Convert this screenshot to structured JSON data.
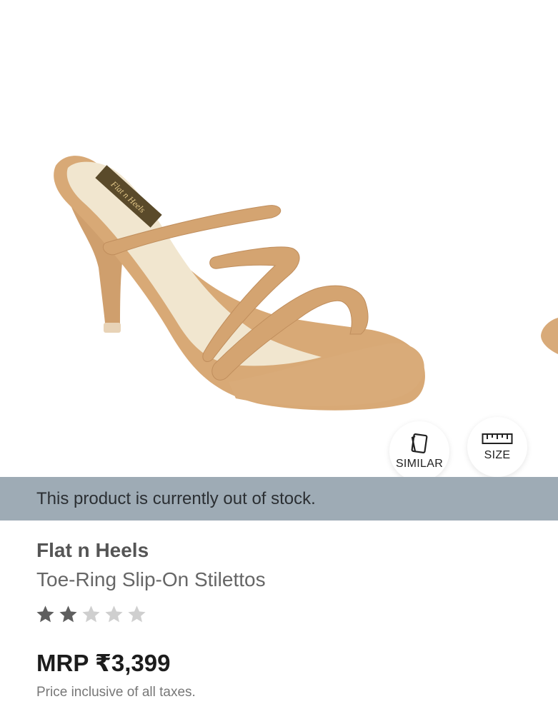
{
  "product_image": {
    "alt": "Tan toe-ring strappy stiletto sandal",
    "insole_brand": "Flat n Heels"
  },
  "actions": {
    "similar_label": "SIMILAR",
    "similar_icon": "cards-icon",
    "size_label": "SIZE",
    "size_icon": "ruler-icon"
  },
  "stock_banner": {
    "text": "This product is currently out of stock."
  },
  "product": {
    "brand": "Flat n Heels",
    "name": "Toe-Ring Slip-On Stilettos",
    "rating": 2,
    "rating_max": 5,
    "price": "MRP ₹3,399",
    "tax_note": "Price inclusive of all taxes."
  },
  "colors": {
    "banner_bg": "#9eabb5",
    "star_filled": "#5f5f5f",
    "star_empty": "#cfcfcf",
    "sandal_tan": "#d6a877"
  }
}
